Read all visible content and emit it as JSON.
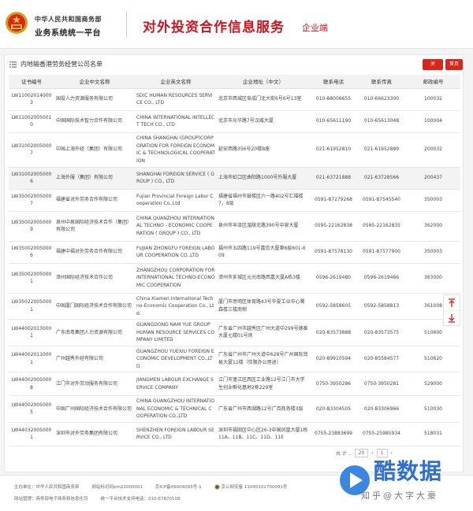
{
  "header": {
    "org_line1": "中华人民共和国商务部",
    "org_line2": "业务系统统一平台",
    "service_title": "对外投资合作信息服务",
    "service_sub": "企业端"
  },
  "panel": {
    "title": "内地输香港劳务经营公司名单",
    "close_label": "关闭",
    "home_label": "首页"
  },
  "table": {
    "columns": [
      "证书编号",
      "企业中文名称",
      "企业英文名称",
      "企业地址（中文）",
      "联系电话",
      "联系传真",
      "邮政编号"
    ],
    "rows": [
      [
        "LW110020140003",
        "国投人力资源服务有限公司",
        "SDIC HUMAN RESOURCES SERVICE CO., LTD",
        "北京市西城区阜成门北大街6号6号13室",
        "010-88006655",
        "010-66623300",
        "100032"
      ],
      [
        "LW110020050010",
        "中国国际技术智力合作有限公司",
        "CHINA INTERNATIONAL INTELLECT TECH CO., LTD",
        "北京市光华路7号汉威大厦",
        "010-65611190",
        "010-65613048",
        "100004"
      ],
      [
        "LW310020050007",
        "中国上海外经（集团）有限公司",
        "CHINA SHANGHAI (GROUP)CORPORATION FOR FOREIGN ECONOMIC & TECHNOLOGICAL COOPERATION",
        "延安西路356号20楼B座",
        "021-61952810",
        "021-61952889",
        "200032"
      ],
      [
        "LW310020050006",
        "上海外服（集团）有限公司",
        "SHANGHAI FOREIGN SERVICE ( GROUP ) CO., LTD",
        "上海市虹口区曲阳路1000号外服大厦",
        "021-63721888",
        "021-63728566",
        "200437"
      ],
      [
        "LW350020050007",
        "福建省对外劳务合作有限公司",
        "Fujian Provincial Foreign Labor Cooperation Co.,Ltd",
        "福建省福州市鼓楼区六一路402号汇福楼7，8层",
        "0591-87279268",
        "0591-87545540",
        "350003"
      ],
      [
        "LW350020050009",
        "泉州中泉国际经济技术合作（集团）有限公司",
        "CHINA QUANZHOU INTERNATIONAL TECHNO - ECONOMIC COOPERATION ( GROUP ) CO., LTD",
        "泉州市丰泽区温陵北路390号中泉大厦",
        "0595-22162838",
        "0595-22162835",
        "362000"
      ],
      [
        "LW350020050006",
        "福建中福对外劳务合作有限公司",
        "FUJIAN ZHONGFU FOREIGN LABOUR COOPERATION CO.,LTD",
        "福州市五四路119号嘉信大厦第6层601-609",
        "0591-87578130",
        "0591-87577900",
        "350003"
      ],
      [
        "LW350020050001",
        "漳州国际经济技术合作公司",
        "ZHANGZHOU CORPORATION FOR INTERNATIONAL TECHNO-ECONOMIC COOPERATION",
        "漳州市芗城区元光南路西嘉大厦A栋3楼",
        "0596-2619480",
        "0596-2619466",
        "363000"
      ],
      [
        "LW350220050001",
        "中国厦门国际经济技术合作有限公司",
        "China Xiamen International Techno-Economic Cooperation Co., Ltd.",
        "厦门市思明区体育路43号华夏工业中心鹭森楼三楼南侧",
        "0592-5858605",
        "0592-5858813",
        "361008"
      ],
      [
        "LW440020130001",
        "广东南粤集团人力资源有限公司",
        "GUANGDONG NAM YUE GROUP HUMAN RESOURCE SERVICES COMPANY LIMITED",
        "广东省广州市越秀区广州大道中299号德泰大厦七楼01号房",
        "020-83573888",
        "020-83573575",
        "510600"
      ],
      [
        "LW440020110001",
        "广州越秀外经有限公司",
        "GUANGZHOU YUEXIU FOREIGN ECONOMIC DEVELOPMENT CO.,LTD",
        "广东省广州市广州大道中628号广州国际贸易大厦11楼（仅限办公用途）",
        "020-89910594",
        "020-85584577",
        "510620"
      ],
      [
        "LW440020050008",
        "江门市对外劳动服务有限公司",
        "JIANGMEN LABOUR EXCHANGE SERVICE COMPANY",
        "江门市蓬江区西区工业路12号江门市大学生创业孵化基地2栋229室",
        "0750-3950286",
        "0750-3950281",
        "529000"
      ],
      [
        "LW440020050005",
        "中国广州国际经济技术合作有限公司",
        "CHINA GUANGZHOU INTERNATIONAL ECONOMIC & TECHNICAL COOPERATION CO.,LTD",
        "广东省广州市西湖路12号广百商务楼3层",
        "020-83304505",
        "020-83306966",
        "510030"
      ],
      [
        "LW440320050001",
        "深圳市对外劳务集团有限公司",
        "SHENZHEN FOREIGN LABOUR SERVICE CO., LTD",
        "深圳市福田区中心区26-3中国凤凰大厦1栋11A、11B、11C、11D、11E",
        "0755-23883699",
        "0755-25985934",
        "518031"
      ]
    ]
  },
  "pager": {
    "page_size": "20",
    "page_input": "1"
  },
  "footer": {
    "sponsor": "主办单位：中华人民共和国商务部",
    "icp_beian": "网站标识码bm22000001",
    "icp": "京ICP备05004093号-1",
    "police": "京公网安备 11040102700091号",
    "operator": "网站管理：商务部电子商务和信息化司",
    "support": "统一平台技术支持电话：010-67870108"
  },
  "watermark": {
    "text": "酷数据",
    "sub": "知乎@大字大豪"
  },
  "colors": {
    "brand_red": "#c9151e",
    "button_red": "#d9261c",
    "watermark_blue": "#2f6fd0"
  }
}
